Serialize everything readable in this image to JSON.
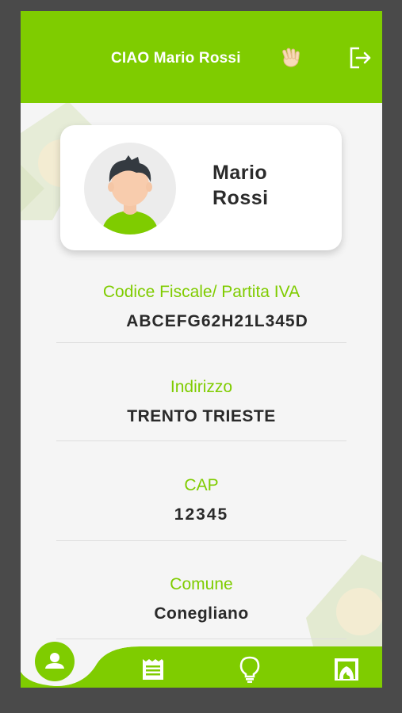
{
  "header": {
    "greeting": "CIAO Mario Rossi",
    "wave_icon": "waving-hand-icon",
    "logout_icon": "logout-icon"
  },
  "profile": {
    "first_name": "Mario",
    "last_name": "Rossi",
    "avatar_icon": "user-avatar-icon"
  },
  "fields": [
    {
      "label": "Codice Fiscale/ Partita IVA",
      "value": "ABCEFG62H21L345D"
    },
    {
      "label": "Indirizzo",
      "value": "TRENTO TRIESTE"
    },
    {
      "label": "CAP",
      "value": "12345"
    },
    {
      "label": "Comune",
      "value": "Conegliano"
    }
  ],
  "nav": {
    "items": [
      "profile-icon",
      "receipt-icon",
      "lightbulb-icon",
      "fireplace-icon"
    ],
    "active": "profile-icon"
  },
  "colors": {
    "brand": "#7fcc00",
    "background": "#f5f5f5",
    "frame": "#4a4a4a"
  }
}
